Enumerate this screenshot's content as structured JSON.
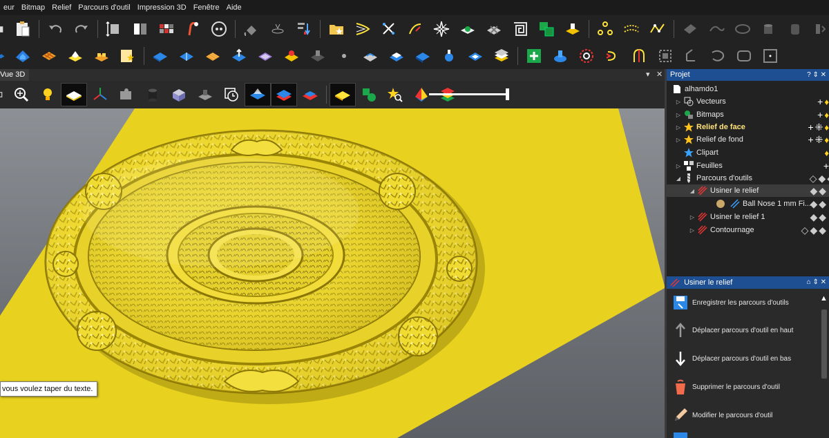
{
  "menu": [
    "eur",
    "Bitmap",
    "Relief",
    "Parcours d'outil",
    "Impression 3D",
    "Fenêtre",
    "Aide"
  ],
  "view_tab": {
    "label": "Vue 3D",
    "pin": "▾",
    "close": "✕"
  },
  "project_panel": {
    "title": "Projet",
    "controls": "? ⇕ ✕",
    "root": "alhamdo1",
    "items": [
      {
        "label": "Vecteurs"
      },
      {
        "label": "Bitmaps"
      },
      {
        "label": "Relief de face"
      },
      {
        "label": "Relief de fond"
      },
      {
        "label": "Clipart"
      },
      {
        "label": "Feuilles"
      },
      {
        "label": "Parcours d'outils"
      },
      {
        "label": "Usiner le relief"
      },
      {
        "label": "Ball Nose 1 mm Fi..."
      },
      {
        "label": "Usiner le relief 1"
      },
      {
        "label": "Contournage"
      }
    ]
  },
  "toolpath_panel": {
    "title": "Usiner le relief",
    "controls": "⌂ ⇕ ✕",
    "actions": [
      {
        "label": "Enregistrer les parcours d'outils"
      },
      {
        "label": "Déplacer parcours d'outil en haut"
      },
      {
        "label": "Déplacer parcours d'outil en bas"
      },
      {
        "label": "Supprimer le parcours d'outil"
      },
      {
        "label": "Modifier le parcours d'outil"
      }
    ],
    "scroll_up": "▲"
  },
  "tooltip": "vous voulez taper du texte.",
  "icon_glyphs": {
    "plus": "+",
    "grid": "⁜",
    "bulb": "💡",
    "collapsed": "▷",
    "expanded": "◢"
  },
  "colors": {
    "accent": "#1e4f92",
    "relief": "#f2dc3a",
    "ground": "#e8d21f"
  }
}
